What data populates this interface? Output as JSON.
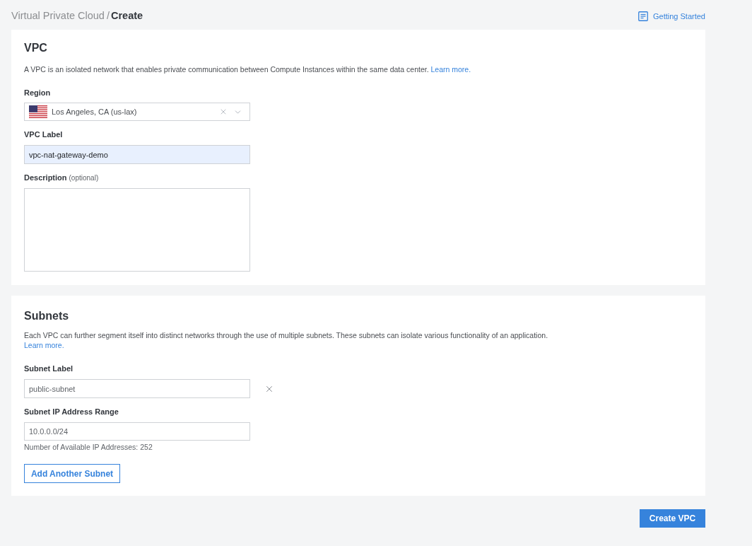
{
  "breadcrumb": {
    "parent": "Virtual Private Cloud",
    "separator": "/",
    "current": "Create"
  },
  "getting_started_link": "Getting Started",
  "vpc_section": {
    "title": "VPC",
    "description": "A VPC is an isolated network that enables private communication between Compute Instances within the same data center.",
    "learn_more": "Learn more.",
    "region": {
      "label": "Region",
      "value": "Los Angeles, CA (us-lax)"
    },
    "vpc_label": {
      "label": "VPC Label",
      "value": "vpc-nat-gateway-demo",
      "autofilled": true
    },
    "description_field": {
      "label": "Description",
      "hint": "(optional)"
    }
  },
  "subnets_section": {
    "title": "Subnets",
    "description": "Each VPC can further segment itself into distinct networks through the use of multiple subnets. These subnets can isolate various functionality of an application.",
    "learn_more": "Learn more.",
    "subnets": [
      {
        "label_field": {
          "label": "Subnet Label",
          "value": "public-subnet"
        },
        "ip_range": {
          "label": "Subnet IP Address Range",
          "value": "10.0.0.0/24"
        },
        "available": "Number of Available IP Addresses: 252"
      }
    ],
    "add_button": "Add Another Subnet"
  },
  "submit_button": "Create VPC"
}
